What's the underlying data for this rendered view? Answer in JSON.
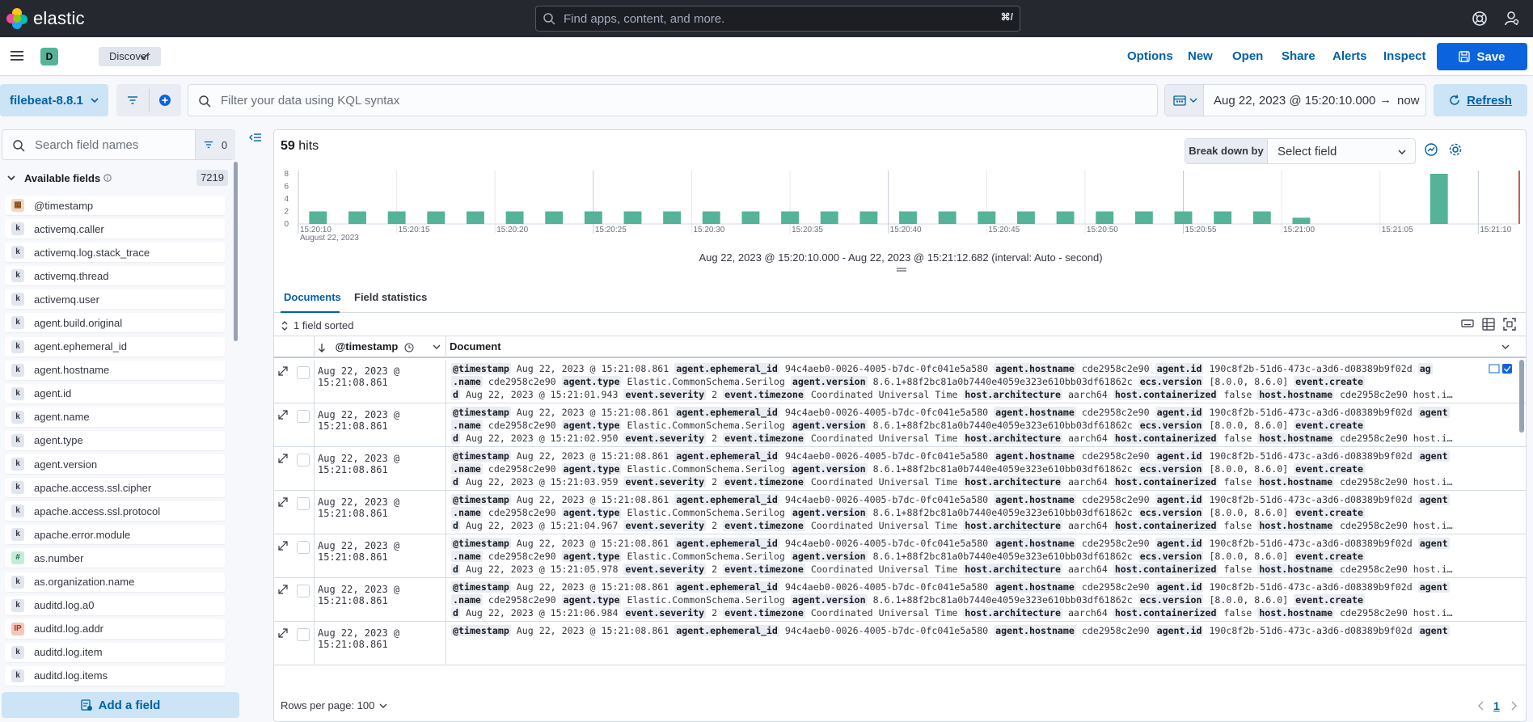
{
  "topbar": {
    "brand": "elastic",
    "search_placeholder": "Find apps, content, and more.",
    "search_shortcut": "⌘/"
  },
  "appbar": {
    "space_initial": "D",
    "breadcrumb": "Discover",
    "menu": [
      "Options",
      "New",
      "Open",
      "Share",
      "Alerts",
      "Inspect"
    ],
    "save_label": "Save"
  },
  "query": {
    "data_view": "filebeat-8.8.1",
    "kql_placeholder": "Filter your data using KQL syntax",
    "date_start": "Aug 22, 2023 @ 15:20:10.000",
    "date_arrow": "→",
    "date_end": "now",
    "refresh_label": "Refresh"
  },
  "sidebar": {
    "search_placeholder": "Search field names",
    "filter_count": "0",
    "available_title": "Available fields",
    "available_count": "7219",
    "fields": [
      {
        "name": "@timestamp",
        "type": "date",
        "glyph": "▦"
      },
      {
        "name": "activemq.caller",
        "type": "keyword",
        "glyph": "k"
      },
      {
        "name": "activemq.log.stack_trace",
        "type": "keyword",
        "glyph": "k"
      },
      {
        "name": "activemq.thread",
        "type": "keyword",
        "glyph": "k"
      },
      {
        "name": "activemq.user",
        "type": "keyword",
        "glyph": "k"
      },
      {
        "name": "agent.build.original",
        "type": "keyword",
        "glyph": "k"
      },
      {
        "name": "agent.ephemeral_id",
        "type": "keyword",
        "glyph": "k"
      },
      {
        "name": "agent.hostname",
        "type": "keyword",
        "glyph": "k"
      },
      {
        "name": "agent.id",
        "type": "keyword",
        "glyph": "k"
      },
      {
        "name": "agent.name",
        "type": "keyword",
        "glyph": "k"
      },
      {
        "name": "agent.type",
        "type": "keyword",
        "glyph": "k"
      },
      {
        "name": "agent.version",
        "type": "keyword",
        "glyph": "k"
      },
      {
        "name": "apache.access.ssl.cipher",
        "type": "keyword",
        "glyph": "k"
      },
      {
        "name": "apache.access.ssl.protocol",
        "type": "keyword",
        "glyph": "k"
      },
      {
        "name": "apache.error.module",
        "type": "keyword",
        "glyph": "k"
      },
      {
        "name": "as.number",
        "type": "number",
        "glyph": "#"
      },
      {
        "name": "as.organization.name",
        "type": "keyword",
        "glyph": "k"
      },
      {
        "name": "auditd.log.a0",
        "type": "keyword",
        "glyph": "k"
      },
      {
        "name": "auditd.log.addr",
        "type": "ip",
        "glyph": "IP"
      },
      {
        "name": "auditd.log.item",
        "type": "keyword",
        "glyph": "k"
      },
      {
        "name": "auditd.log.items",
        "type": "keyword",
        "glyph": "k"
      }
    ],
    "add_field_label": "Add a field"
  },
  "main": {
    "hits_count": "59",
    "hits_label": "hits",
    "breakdown_label": "Break down by",
    "breakdown_value": "Select field",
    "interval_text": "Aug 22, 2023 @ 15:20:10.000 - Aug 22, 2023 @ 15:21:12.682 (interval: Auto - second)",
    "tabs": [
      "Documents",
      "Field statistics"
    ],
    "sort_info": "1 field sorted",
    "columns": [
      "@timestamp",
      "Document"
    ],
    "rows_per_page": "Rows per page: 100",
    "page_number": "1",
    "rows": [
      {
        "ts": "Aug 22, 2023 @ 15:21:08.861",
        "line1": [
          [
            "@timestamp",
            "Aug 22, 2023 @ 15:21:08.861"
          ],
          [
            "agent.ephemeral_id",
            "94c4aeb0-0026-4005-b7dc-0fc041e5a580"
          ],
          [
            "agent.hostname",
            "cde2958c2e90"
          ],
          [
            "agent.id",
            "190c8f2b-51d6-473c-a3d6-d08389b9f02d"
          ],
          [
            "ag",
            ""
          ]
        ],
        "line2": [
          [
            ".name",
            "cde2958c2e90"
          ],
          [
            "agent.type",
            "Elastic.CommonSchema.Serilog"
          ],
          [
            "agent.version",
            "8.6.1+88f2bc81a0b7440e4059e323e610bb03df61862c"
          ],
          [
            "ecs.version",
            "[8.0.0, 8.6.0]"
          ],
          [
            "event.create",
            ""
          ]
        ],
        "line3": [
          [
            "d",
            "Aug 22, 2023 @ 15:21:01.943"
          ],
          [
            "event.severity",
            "2"
          ],
          [
            "event.timezone",
            "Coordinated Universal Time"
          ],
          [
            "host.architecture",
            "aarch64"
          ],
          [
            "host.containerized",
            "false"
          ],
          [
            "host.hostname",
            "cde2958c2e90 host.i…"
          ]
        ]
      },
      {
        "ts": "Aug 22, 2023 @ 15:21:08.861",
        "line1": [
          [
            "@timestamp",
            "Aug 22, 2023 @ 15:21:08.861"
          ],
          [
            "agent.ephemeral_id",
            "94c4aeb0-0026-4005-b7dc-0fc041e5a580"
          ],
          [
            "agent.hostname",
            "cde2958c2e90"
          ],
          [
            "agent.id",
            "190c8f2b-51d6-473c-a3d6-d08389b9f02d"
          ],
          [
            "agent",
            ""
          ]
        ],
        "line2": [
          [
            ".name",
            "cde2958c2e90"
          ],
          [
            "agent.type",
            "Elastic.CommonSchema.Serilog"
          ],
          [
            "agent.version",
            "8.6.1+88f2bc81a0b7440e4059e323e610bb03df61862c"
          ],
          [
            "ecs.version",
            "[8.0.0, 8.6.0]"
          ],
          [
            "event.create",
            ""
          ]
        ],
        "line3": [
          [
            "d",
            "Aug 22, 2023 @ 15:21:02.950"
          ],
          [
            "event.severity",
            "2"
          ],
          [
            "event.timezone",
            "Coordinated Universal Time"
          ],
          [
            "host.architecture",
            "aarch64"
          ],
          [
            "host.containerized",
            "false"
          ],
          [
            "host.hostname",
            "cde2958c2e90 host.i…"
          ]
        ]
      },
      {
        "ts": "Aug 22, 2023 @ 15:21:08.861",
        "line1": [
          [
            "@timestamp",
            "Aug 22, 2023 @ 15:21:08.861"
          ],
          [
            "agent.ephemeral_id",
            "94c4aeb0-0026-4005-b7dc-0fc041e5a580"
          ],
          [
            "agent.hostname",
            "cde2958c2e90"
          ],
          [
            "agent.id",
            "190c8f2b-51d6-473c-a3d6-d08389b9f02d"
          ],
          [
            "agent",
            ""
          ]
        ],
        "line2": [
          [
            ".name",
            "cde2958c2e90"
          ],
          [
            "agent.type",
            "Elastic.CommonSchema.Serilog"
          ],
          [
            "agent.version",
            "8.6.1+88f2bc81a0b7440e4059e323e610bb03df61862c"
          ],
          [
            "ecs.version",
            "[8.0.0, 8.6.0]"
          ],
          [
            "event.create",
            ""
          ]
        ],
        "line3": [
          [
            "d",
            "Aug 22, 2023 @ 15:21:03.959"
          ],
          [
            "event.severity",
            "2"
          ],
          [
            "event.timezone",
            "Coordinated Universal Time"
          ],
          [
            "host.architecture",
            "aarch64"
          ],
          [
            "host.containerized",
            "false"
          ],
          [
            "host.hostname",
            "cde2958c2e90 host.i…"
          ]
        ]
      },
      {
        "ts": "Aug 22, 2023 @ 15:21:08.861",
        "line1": [
          [
            "@timestamp",
            "Aug 22, 2023 @ 15:21:08.861"
          ],
          [
            "agent.ephemeral_id",
            "94c4aeb0-0026-4005-b7dc-0fc041e5a580"
          ],
          [
            "agent.hostname",
            "cde2958c2e90"
          ],
          [
            "agent.id",
            "190c8f2b-51d6-473c-a3d6-d08389b9f02d"
          ],
          [
            "agent",
            ""
          ]
        ],
        "line2": [
          [
            ".name",
            "cde2958c2e90"
          ],
          [
            "agent.type",
            "Elastic.CommonSchema.Serilog"
          ],
          [
            "agent.version",
            "8.6.1+88f2bc81a0b7440e4059e323e610bb03df61862c"
          ],
          [
            "ecs.version",
            "[8.0.0, 8.6.0]"
          ],
          [
            "event.create",
            ""
          ]
        ],
        "line3": [
          [
            "d",
            "Aug 22, 2023 @ 15:21:04.967"
          ],
          [
            "event.severity",
            "2"
          ],
          [
            "event.timezone",
            "Coordinated Universal Time"
          ],
          [
            "host.architecture",
            "aarch64"
          ],
          [
            "host.containerized",
            "false"
          ],
          [
            "host.hostname",
            "cde2958c2e90 host.i…"
          ]
        ]
      },
      {
        "ts": "Aug 22, 2023 @ 15:21:08.861",
        "line1": [
          [
            "@timestamp",
            "Aug 22, 2023 @ 15:21:08.861"
          ],
          [
            "agent.ephemeral_id",
            "94c4aeb0-0026-4005-b7dc-0fc041e5a580"
          ],
          [
            "agent.hostname",
            "cde2958c2e90"
          ],
          [
            "agent.id",
            "190c8f2b-51d6-473c-a3d6-d08389b9f02d"
          ],
          [
            "agent",
            ""
          ]
        ],
        "line2": [
          [
            ".name",
            "cde2958c2e90"
          ],
          [
            "agent.type",
            "Elastic.CommonSchema.Serilog"
          ],
          [
            "agent.version",
            "8.6.1+88f2bc81a0b7440e4059e323e610bb03df61862c"
          ],
          [
            "ecs.version",
            "[8.0.0, 8.6.0]"
          ],
          [
            "event.create",
            ""
          ]
        ],
        "line3": [
          [
            "d",
            "Aug 22, 2023 @ 15:21:05.978"
          ],
          [
            "event.severity",
            "2"
          ],
          [
            "event.timezone",
            "Coordinated Universal Time"
          ],
          [
            "host.architecture",
            "aarch64"
          ],
          [
            "host.containerized",
            "false"
          ],
          [
            "host.hostname",
            "cde2958c2e90 host.i…"
          ]
        ]
      },
      {
        "ts": "Aug 22, 2023 @ 15:21:08.861",
        "line1": [
          [
            "@timestamp",
            "Aug 22, 2023 @ 15:21:08.861"
          ],
          [
            "agent.ephemeral_id",
            "94c4aeb0-0026-4005-b7dc-0fc041e5a580"
          ],
          [
            "agent.hostname",
            "cde2958c2e90"
          ],
          [
            "agent.id",
            "190c8f2b-51d6-473c-a3d6-d08389b9f02d"
          ],
          [
            "agent",
            ""
          ]
        ],
        "line2": [
          [
            ".name",
            "cde2958c2e90"
          ],
          [
            "agent.type",
            "Elastic.CommonSchema.Serilog"
          ],
          [
            "agent.version",
            "8.6.1+88f2bc81a0b7440e4059e323e610bb03df61862c"
          ],
          [
            "ecs.version",
            "[8.0.0, 8.6.0]"
          ],
          [
            "event.create",
            ""
          ]
        ],
        "line3": [
          [
            "d",
            "Aug 22, 2023 @ 15:21:06.984"
          ],
          [
            "event.severity",
            "2"
          ],
          [
            "event.timezone",
            "Coordinated Universal Time"
          ],
          [
            "host.architecture",
            "aarch64"
          ],
          [
            "host.containerized",
            "false"
          ],
          [
            "host.hostname",
            "cde2958c2e90 host.i…"
          ]
        ]
      },
      {
        "ts": "Aug 22, 2023 @ 15:21:08.861",
        "line1": [
          [
            "@timestamp",
            "Aug 22, 2023 @ 15:21:08.861"
          ],
          [
            "agent.ephemeral_id",
            "94c4aeb0-0026-4005-b7dc-0fc041e5a580"
          ],
          [
            "agent.hostname",
            "cde2958c2e90"
          ],
          [
            "agent.id",
            "190c8f2b-51d6-473c-a3d6-d08389b9f02d"
          ],
          [
            "agent",
            ""
          ]
        ],
        "line2": [],
        "line3": []
      }
    ]
  },
  "colors": {
    "accent": "#0b64dd",
    "link": "#0061a6",
    "bar": "#54b399",
    "topbar": "#25282f",
    "now_marker": "#bd271e"
  },
  "chart_data": {
    "type": "bar",
    "x_tick_labels": [
      "15:20:10",
      "15:20:15",
      "15:20:20",
      "15:20:25",
      "15:20:30",
      "15:20:35",
      "15:20:40",
      "15:20:45",
      "15:20:50",
      "15:20:55",
      "15:21:00",
      "15:21:05",
      "15:21:10"
    ],
    "x_sublabel": "August 22, 2023",
    "y_tick_labels": [
      "0",
      "2",
      "4",
      "6",
      "8"
    ],
    "ylim": [
      0,
      8
    ],
    "bin_seconds": 1,
    "start_second": "15:20:10",
    "values": [
      0,
      2,
      0,
      2,
      0,
      2,
      0,
      2,
      0,
      2,
      0,
      2,
      0,
      2,
      0,
      2,
      0,
      2,
      0,
      2,
      0,
      2,
      0,
      2,
      0,
      2,
      0,
      2,
      0,
      2,
      0,
      2,
      0,
      2,
      0,
      2,
      0,
      2,
      0,
      2,
      0,
      2,
      0,
      2,
      0,
      2,
      0,
      2,
      0,
      2,
      0,
      1,
      0,
      0,
      0,
      0,
      0,
      0,
      8,
      0,
      0,
      0
    ],
    "grid": "vertical",
    "legend": "none"
  }
}
